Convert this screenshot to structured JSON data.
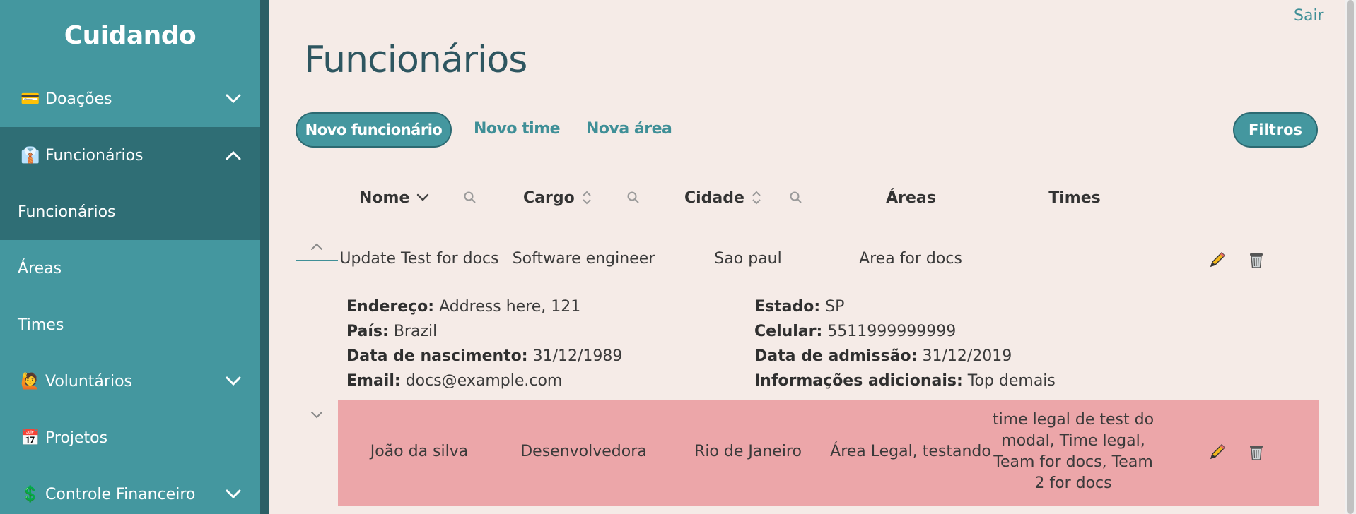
{
  "sidebar": {
    "brand": "Cuidando",
    "items": [
      {
        "icon": "credit-card-icon",
        "emoji": "💳",
        "label": "Doações"
      },
      {
        "icon": "person-icon",
        "emoji": "👔",
        "label": "Funcionários"
      },
      {
        "label": "Funcionários"
      },
      {
        "label": "Áreas"
      },
      {
        "label": "Times"
      },
      {
        "icon": "volunteer-icon",
        "emoji": "🙋",
        "label": "Voluntários"
      },
      {
        "icon": "calendar-icon",
        "emoji": "📅",
        "label": "Projetos"
      },
      {
        "icon": "dollar-icon",
        "emoji": "💲",
        "label": "Controle Financeiro"
      }
    ]
  },
  "header": {
    "logout": "Sair",
    "title": "Funcionários"
  },
  "toolbar": {
    "new_employee": "Novo funcionário",
    "new_team": "Novo time",
    "new_area": "Nova área",
    "filters": "Filtros"
  },
  "table": {
    "columns": [
      "Nome",
      "Cargo",
      "Cidade",
      "Áreas",
      "Times"
    ],
    "rows": [
      {
        "name": "Update Test for docs",
        "role": "Software engineer",
        "city": "Sao paul",
        "areas": "Area for docs",
        "teams": "",
        "details": {
          "address_label": "Endereço:",
          "address": "Address here, 121",
          "country_label": "País:",
          "country": "Brazil",
          "birth_label": "Data de nascimento:",
          "birth": "31/12/1989",
          "email_label": "Email:",
          "email": "docs@example.com",
          "state_label": "Estado:",
          "state": "SP",
          "phone_label": "Celular:",
          "phone": "5511999999999",
          "admission_label": "Data de admissão:",
          "admission": "31/12/2019",
          "info_label": "Informações adicionais:",
          "info": "Top demais"
        }
      },
      {
        "name": "João da silva",
        "role": "Desenvolvedora",
        "city": "Rio de Janeiro",
        "areas": "Área Legal, testando",
        "teams_lines": [
          "time legal de test do",
          "modal, Time legal,",
          "Team for docs, Team",
          "2 for docs"
        ]
      }
    ]
  },
  "colors": {
    "sidebar": "#44979f",
    "sidebar_active": "#2f6e75",
    "background": "#f5ebe7",
    "highlight_row": "#eca6a9",
    "accent": "#3f8f97"
  }
}
